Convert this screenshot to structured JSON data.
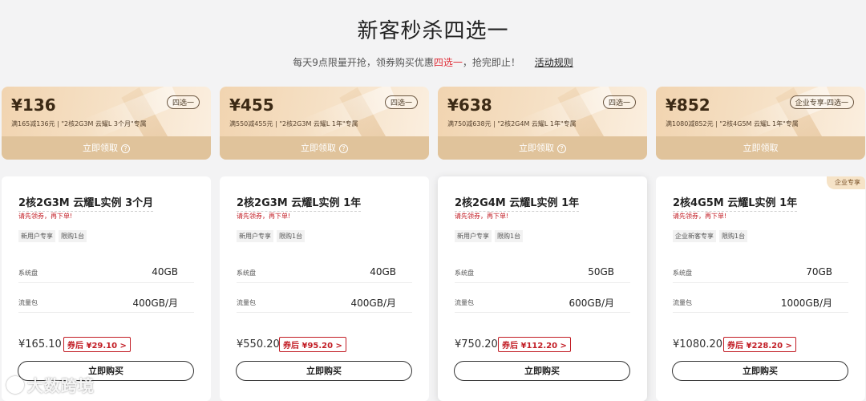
{
  "header": {
    "title": "新客秒杀四选一",
    "subtitle_pre": "每天9点限量开抢，领券购买优惠",
    "subtitle_highlight": "四选一",
    "subtitle_post": "，抢完即止！",
    "rules_link": "活动规则"
  },
  "coupons": [
    {
      "amount": "¥136",
      "desc": "满165减136元 | \"2核2G3M 云耀L 3个月\"专属",
      "tag": "四选一",
      "claim_label": "立即领取",
      "help_icon": "?"
    },
    {
      "amount": "¥455",
      "desc": "满550减455元 | \"2核2G3M 云耀L 1年\"专属",
      "tag": "四选一",
      "claim_label": "立即领取",
      "help_icon": "?"
    },
    {
      "amount": "¥638",
      "desc": "满750减638元 | \"2核2G4M 云耀L 1年\"专属",
      "tag": "四选一",
      "claim_label": "立即领取",
      "help_icon": "?"
    },
    {
      "amount": "¥852",
      "desc": "满1080减852元 | \"2核4G5M 云耀L 1年\"专属",
      "tag": "企业专享-四选一",
      "claim_label": "立即领取"
    }
  ],
  "products": [
    {
      "name": "2核2G3M 云耀L实例 3个月",
      "note": "请先领券，再下单!",
      "badges": [
        "新用户专享",
        "限购1台"
      ],
      "disk_label": "系统盘",
      "disk_value": "40GB",
      "traffic_label": "流量包",
      "traffic_value": "400GB/月",
      "price": "¥165.10",
      "after_coupon": "券后 ¥29.10 >",
      "buy_label": "立即购买"
    },
    {
      "name": "2核2G3M 云耀L实例 1年",
      "note": "请先领券，再下单!",
      "badges": [
        "新用户专享",
        "限购1台"
      ],
      "disk_label": "系统盘",
      "disk_value": "40GB",
      "traffic_label": "流量包",
      "traffic_value": "400GB/月",
      "price": "¥550.20",
      "after_coupon": "券后 ¥95.20 >",
      "buy_label": "立即购买"
    },
    {
      "name": "2核2G4M 云耀L实例 1年",
      "note": "请先领券，再下单!",
      "badges": [
        "新用户专享",
        "限购1台"
      ],
      "disk_label": "系统盘",
      "disk_value": "50GB",
      "traffic_label": "流量包",
      "traffic_value": "600GB/月",
      "price": "¥750.20",
      "after_coupon": "券后 ¥112.20 >",
      "buy_label": "立即购买"
    },
    {
      "name": "2核4G5M 云耀L实例 1年",
      "note": "请先领券，再下单!",
      "badges": [
        "企业新客专享",
        "限购1台"
      ],
      "disk_label": "系统盘",
      "disk_value": "70GB",
      "traffic_label": "流量包",
      "traffic_value": "1000GB/月",
      "price": "¥1080.20",
      "after_coupon": "券后 ¥228.20 >",
      "buy_label": "立即购买",
      "corner_tag": "企业专享"
    }
  ],
  "watermark": "大数跨境"
}
